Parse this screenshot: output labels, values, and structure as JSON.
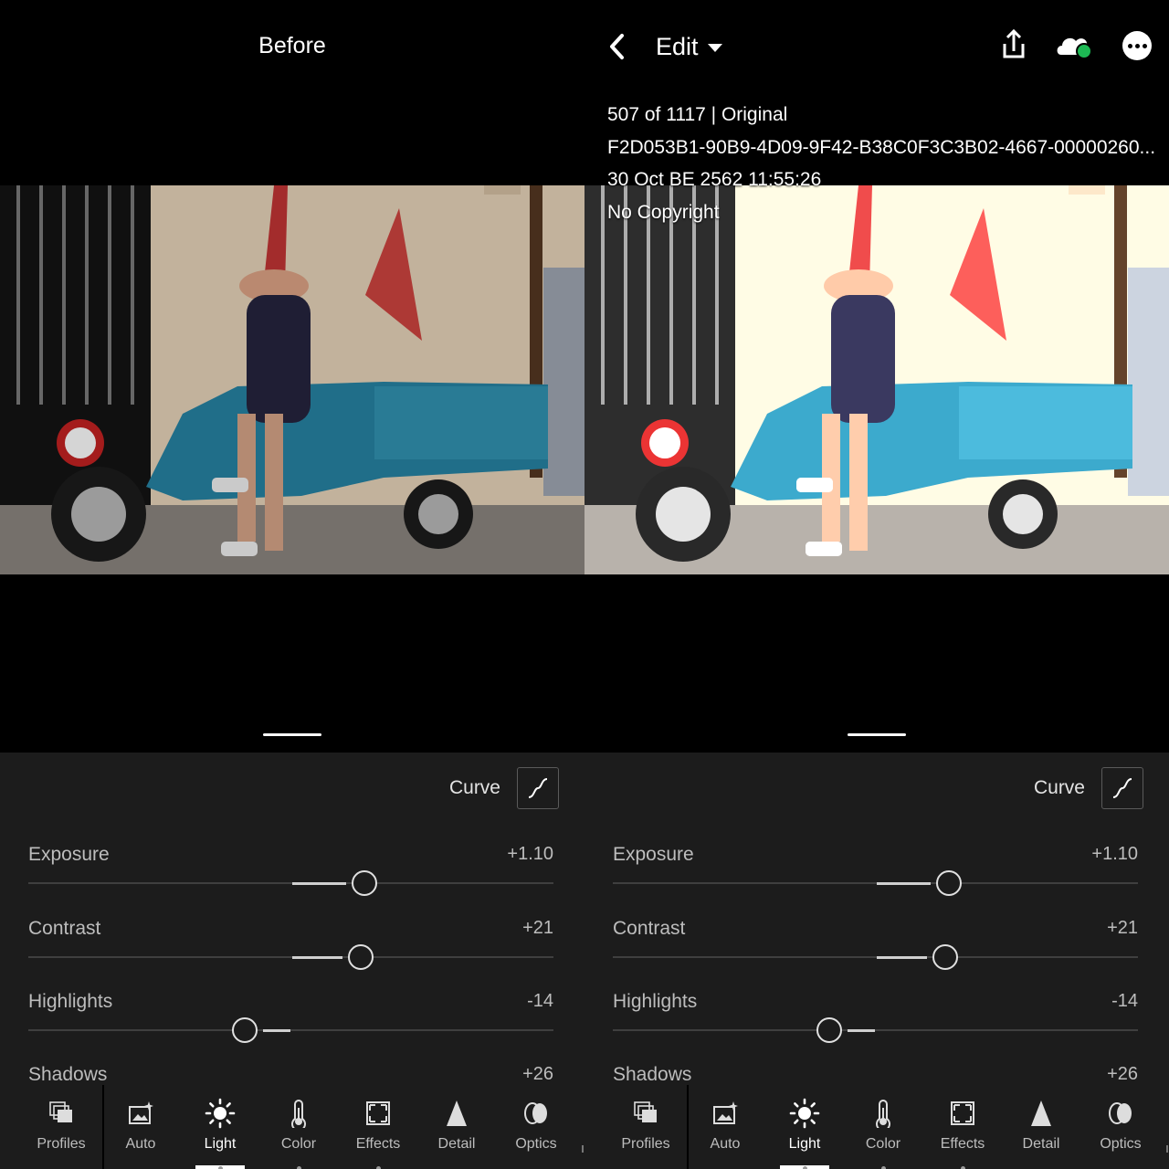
{
  "before_view": {
    "title": "Before"
  },
  "edit_view": {
    "back_label": "",
    "menu_label": "Edit",
    "info": {
      "position": "507 of 1117 | Original",
      "filename": "F2D053B1-90B9-4D09-9F42-B38C0F3C3B02-4667-00000260...",
      "date": "30 Oct BE 2562 11:55:26",
      "copyright": "No Copyright"
    },
    "icons": {
      "back": "chevron-left-icon",
      "share": "share-icon",
      "cloud": "cloud-sync-icon",
      "more": "more-icon"
    },
    "sync_status_color": "#1db954"
  },
  "panel": {
    "curve_label": "Curve",
    "sliders": [
      {
        "name": "Exposure",
        "value_text": "+1.10",
        "value": 1.1,
        "min": -5,
        "max": 5
      },
      {
        "name": "Contrast",
        "value_text": "+21",
        "value": 21,
        "min": -100,
        "max": 100
      },
      {
        "name": "Highlights",
        "value_text": "-14",
        "value": -14,
        "min": -100,
        "max": 100
      },
      {
        "name": "Shadows",
        "value_text": "+26",
        "value": 26,
        "min": -100,
        "max": 100
      }
    ]
  },
  "nav": {
    "items": [
      {
        "label": "Profiles",
        "icon": "profiles-icon"
      },
      {
        "label": "Auto",
        "icon": "auto-icon"
      },
      {
        "label": "Light",
        "icon": "light-icon",
        "active": true
      },
      {
        "label": "Color",
        "icon": "color-icon"
      },
      {
        "label": "Effects",
        "icon": "effects-icon"
      },
      {
        "label": "Detail",
        "icon": "detail-icon"
      },
      {
        "label": "Optics",
        "icon": "optics-icon"
      }
    ]
  },
  "colors": {
    "background": "#000000",
    "panel": "#1c1c1c",
    "accent": "#ffffff",
    "sync_green": "#1db954"
  }
}
